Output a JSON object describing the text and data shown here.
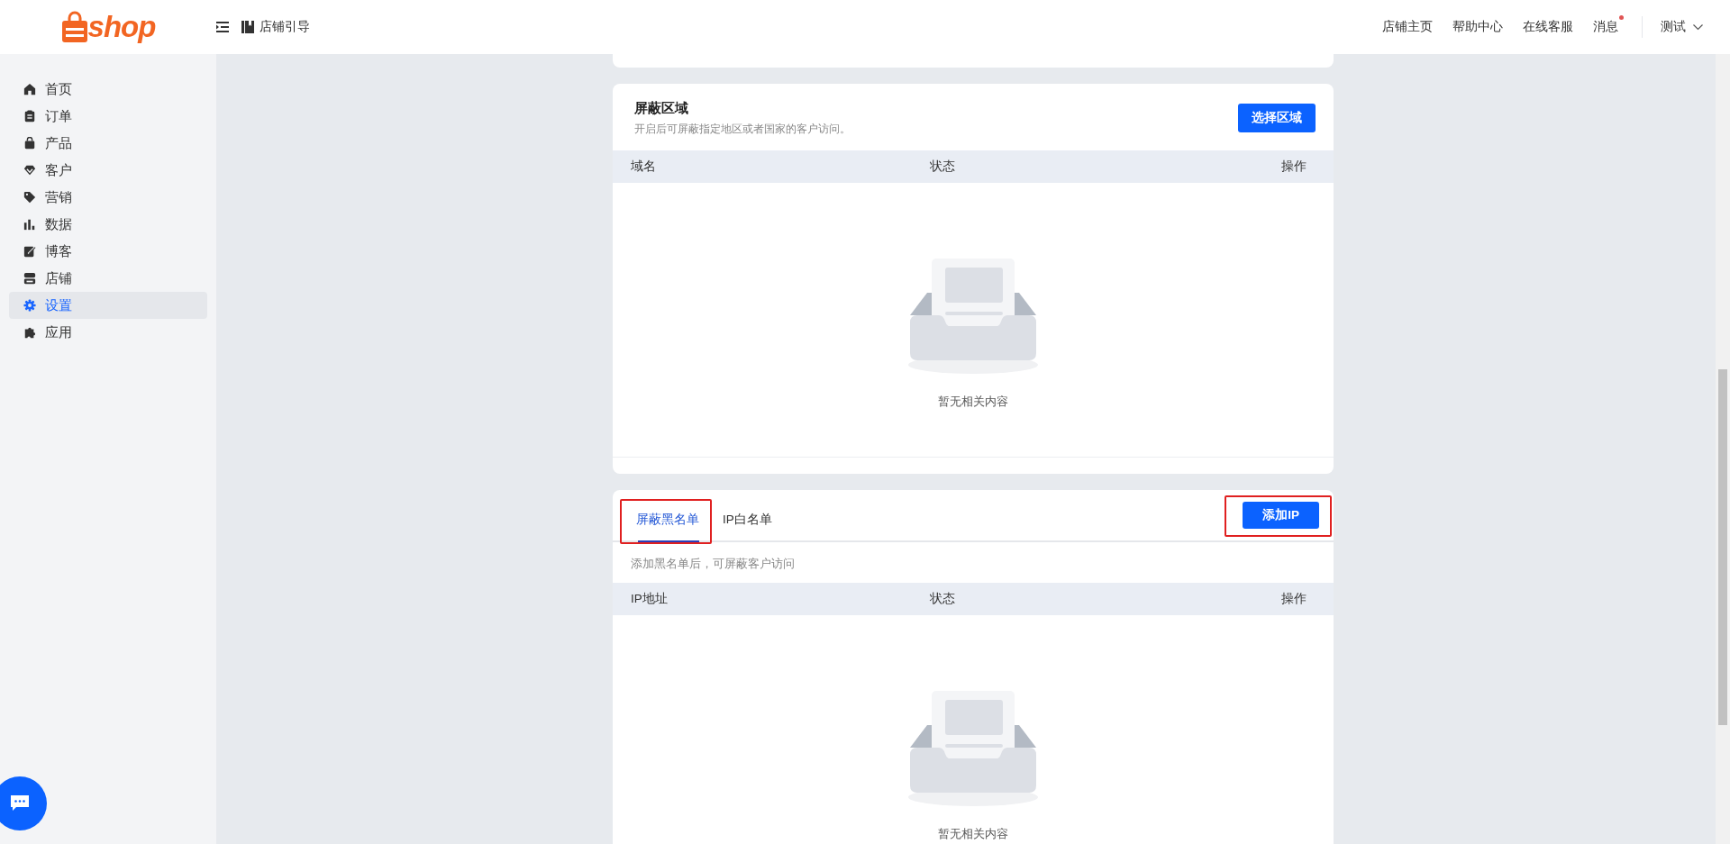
{
  "header": {
    "logo": "shop",
    "guide": "店铺引导",
    "links": [
      {
        "label": "店铺主页",
        "unread": false
      },
      {
        "label": "帮助中心",
        "unread": false
      },
      {
        "label": "在线客服",
        "unread": false
      },
      {
        "label": "消息",
        "unread": true
      }
    ],
    "user": "测试"
  },
  "sidebar": {
    "items": [
      {
        "label": "首页",
        "kind": "home",
        "selected": false
      },
      {
        "label": "订单",
        "kind": "orders",
        "selected": false
      },
      {
        "label": "产品",
        "kind": "products",
        "selected": false
      },
      {
        "label": "客户",
        "kind": "customers",
        "selected": false
      },
      {
        "label": "营销",
        "kind": "marketing",
        "selected": false
      },
      {
        "label": "数据",
        "kind": "data",
        "selected": false
      },
      {
        "label": "博客",
        "kind": "blog",
        "selected": false
      },
      {
        "label": "店铺",
        "kind": "store",
        "selected": false
      },
      {
        "label": "设置",
        "kind": "settings",
        "selected": true
      },
      {
        "label": "应用",
        "kind": "apps",
        "selected": false
      }
    ]
  },
  "region_card": {
    "title": "屏蔽区域",
    "description": "开启后可屏蔽指定地区或者国家的客户访问。",
    "button": "选择区域",
    "table": {
      "columns": [
        "域名",
        "状态",
        "操作"
      ]
    },
    "empty_text": "暂无相关内容"
  },
  "ip_card": {
    "tabs": [
      {
        "label": "屏蔽黑名单",
        "selected": true,
        "highlighted": true
      },
      {
        "label": "IP白名单",
        "selected": false,
        "highlighted": false
      }
    ],
    "button": {
      "label": "添加IP",
      "highlighted": true
    },
    "hint": "添加黑名单后，可屏蔽客户访问",
    "table": {
      "columns": [
        "IP地址",
        "状态",
        "操作"
      ]
    },
    "empty_text": "暂无相关内容"
  }
}
